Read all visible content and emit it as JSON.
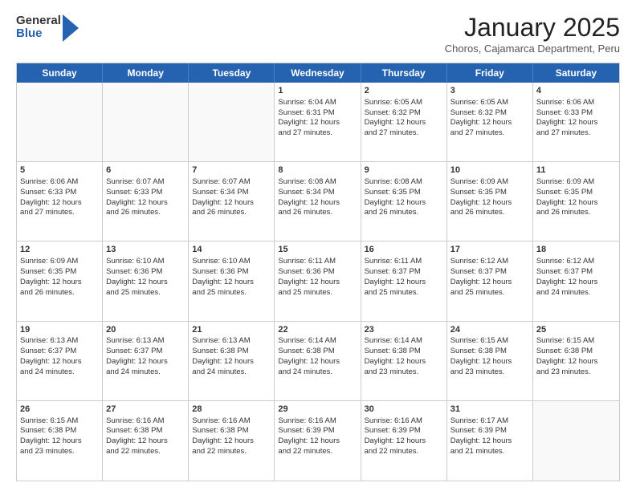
{
  "header": {
    "logo_general": "General",
    "logo_blue": "Blue",
    "month_title": "January 2025",
    "subtitle": "Choros, Cajamarca Department, Peru"
  },
  "weekdays": [
    "Sunday",
    "Monday",
    "Tuesday",
    "Wednesday",
    "Thursday",
    "Friday",
    "Saturday"
  ],
  "weeks": [
    [
      {
        "day": "",
        "empty": true,
        "lines": []
      },
      {
        "day": "",
        "empty": true,
        "lines": []
      },
      {
        "day": "",
        "empty": true,
        "lines": []
      },
      {
        "day": "1",
        "empty": false,
        "lines": [
          "Sunrise: 6:04 AM",
          "Sunset: 6:31 PM",
          "Daylight: 12 hours",
          "and 27 minutes."
        ]
      },
      {
        "day": "2",
        "empty": false,
        "lines": [
          "Sunrise: 6:05 AM",
          "Sunset: 6:32 PM",
          "Daylight: 12 hours",
          "and 27 minutes."
        ]
      },
      {
        "day": "3",
        "empty": false,
        "lines": [
          "Sunrise: 6:05 AM",
          "Sunset: 6:32 PM",
          "Daylight: 12 hours",
          "and 27 minutes."
        ]
      },
      {
        "day": "4",
        "empty": false,
        "lines": [
          "Sunrise: 6:06 AM",
          "Sunset: 6:33 PM",
          "Daylight: 12 hours",
          "and 27 minutes."
        ]
      }
    ],
    [
      {
        "day": "5",
        "empty": false,
        "lines": [
          "Sunrise: 6:06 AM",
          "Sunset: 6:33 PM",
          "Daylight: 12 hours",
          "and 27 minutes."
        ]
      },
      {
        "day": "6",
        "empty": false,
        "lines": [
          "Sunrise: 6:07 AM",
          "Sunset: 6:33 PM",
          "Daylight: 12 hours",
          "and 26 minutes."
        ]
      },
      {
        "day": "7",
        "empty": false,
        "lines": [
          "Sunrise: 6:07 AM",
          "Sunset: 6:34 PM",
          "Daylight: 12 hours",
          "and 26 minutes."
        ]
      },
      {
        "day": "8",
        "empty": false,
        "lines": [
          "Sunrise: 6:08 AM",
          "Sunset: 6:34 PM",
          "Daylight: 12 hours",
          "and 26 minutes."
        ]
      },
      {
        "day": "9",
        "empty": false,
        "lines": [
          "Sunrise: 6:08 AM",
          "Sunset: 6:35 PM",
          "Daylight: 12 hours",
          "and 26 minutes."
        ]
      },
      {
        "day": "10",
        "empty": false,
        "lines": [
          "Sunrise: 6:09 AM",
          "Sunset: 6:35 PM",
          "Daylight: 12 hours",
          "and 26 minutes."
        ]
      },
      {
        "day": "11",
        "empty": false,
        "lines": [
          "Sunrise: 6:09 AM",
          "Sunset: 6:35 PM",
          "Daylight: 12 hours",
          "and 26 minutes."
        ]
      }
    ],
    [
      {
        "day": "12",
        "empty": false,
        "lines": [
          "Sunrise: 6:09 AM",
          "Sunset: 6:35 PM",
          "Daylight: 12 hours",
          "and 26 minutes."
        ]
      },
      {
        "day": "13",
        "empty": false,
        "lines": [
          "Sunrise: 6:10 AM",
          "Sunset: 6:36 PM",
          "Daylight: 12 hours",
          "and 25 minutes."
        ]
      },
      {
        "day": "14",
        "empty": false,
        "lines": [
          "Sunrise: 6:10 AM",
          "Sunset: 6:36 PM",
          "Daylight: 12 hours",
          "and 25 minutes."
        ]
      },
      {
        "day": "15",
        "empty": false,
        "lines": [
          "Sunrise: 6:11 AM",
          "Sunset: 6:36 PM",
          "Daylight: 12 hours",
          "and 25 minutes."
        ]
      },
      {
        "day": "16",
        "empty": false,
        "lines": [
          "Sunrise: 6:11 AM",
          "Sunset: 6:37 PM",
          "Daylight: 12 hours",
          "and 25 minutes."
        ]
      },
      {
        "day": "17",
        "empty": false,
        "lines": [
          "Sunrise: 6:12 AM",
          "Sunset: 6:37 PM",
          "Daylight: 12 hours",
          "and 25 minutes."
        ]
      },
      {
        "day": "18",
        "empty": false,
        "lines": [
          "Sunrise: 6:12 AM",
          "Sunset: 6:37 PM",
          "Daylight: 12 hours",
          "and 24 minutes."
        ]
      }
    ],
    [
      {
        "day": "19",
        "empty": false,
        "lines": [
          "Sunrise: 6:13 AM",
          "Sunset: 6:37 PM",
          "Daylight: 12 hours",
          "and 24 minutes."
        ]
      },
      {
        "day": "20",
        "empty": false,
        "lines": [
          "Sunrise: 6:13 AM",
          "Sunset: 6:37 PM",
          "Daylight: 12 hours",
          "and 24 minutes."
        ]
      },
      {
        "day": "21",
        "empty": false,
        "lines": [
          "Sunrise: 6:13 AM",
          "Sunset: 6:38 PM",
          "Daylight: 12 hours",
          "and 24 minutes."
        ]
      },
      {
        "day": "22",
        "empty": false,
        "lines": [
          "Sunrise: 6:14 AM",
          "Sunset: 6:38 PM",
          "Daylight: 12 hours",
          "and 24 minutes."
        ]
      },
      {
        "day": "23",
        "empty": false,
        "lines": [
          "Sunrise: 6:14 AM",
          "Sunset: 6:38 PM",
          "Daylight: 12 hours",
          "and 23 minutes."
        ]
      },
      {
        "day": "24",
        "empty": false,
        "lines": [
          "Sunrise: 6:15 AM",
          "Sunset: 6:38 PM",
          "Daylight: 12 hours",
          "and 23 minutes."
        ]
      },
      {
        "day": "25",
        "empty": false,
        "lines": [
          "Sunrise: 6:15 AM",
          "Sunset: 6:38 PM",
          "Daylight: 12 hours",
          "and 23 minutes."
        ]
      }
    ],
    [
      {
        "day": "26",
        "empty": false,
        "lines": [
          "Sunrise: 6:15 AM",
          "Sunset: 6:38 PM",
          "Daylight: 12 hours",
          "and 23 minutes."
        ]
      },
      {
        "day": "27",
        "empty": false,
        "lines": [
          "Sunrise: 6:16 AM",
          "Sunset: 6:38 PM",
          "Daylight: 12 hours",
          "and 22 minutes."
        ]
      },
      {
        "day": "28",
        "empty": false,
        "lines": [
          "Sunrise: 6:16 AM",
          "Sunset: 6:38 PM",
          "Daylight: 12 hours",
          "and 22 minutes."
        ]
      },
      {
        "day": "29",
        "empty": false,
        "lines": [
          "Sunrise: 6:16 AM",
          "Sunset: 6:39 PM",
          "Daylight: 12 hours",
          "and 22 minutes."
        ]
      },
      {
        "day": "30",
        "empty": false,
        "lines": [
          "Sunrise: 6:16 AM",
          "Sunset: 6:39 PM",
          "Daylight: 12 hours",
          "and 22 minutes."
        ]
      },
      {
        "day": "31",
        "empty": false,
        "lines": [
          "Sunrise: 6:17 AM",
          "Sunset: 6:39 PM",
          "Daylight: 12 hours",
          "and 21 minutes."
        ]
      },
      {
        "day": "",
        "empty": true,
        "lines": []
      }
    ]
  ]
}
